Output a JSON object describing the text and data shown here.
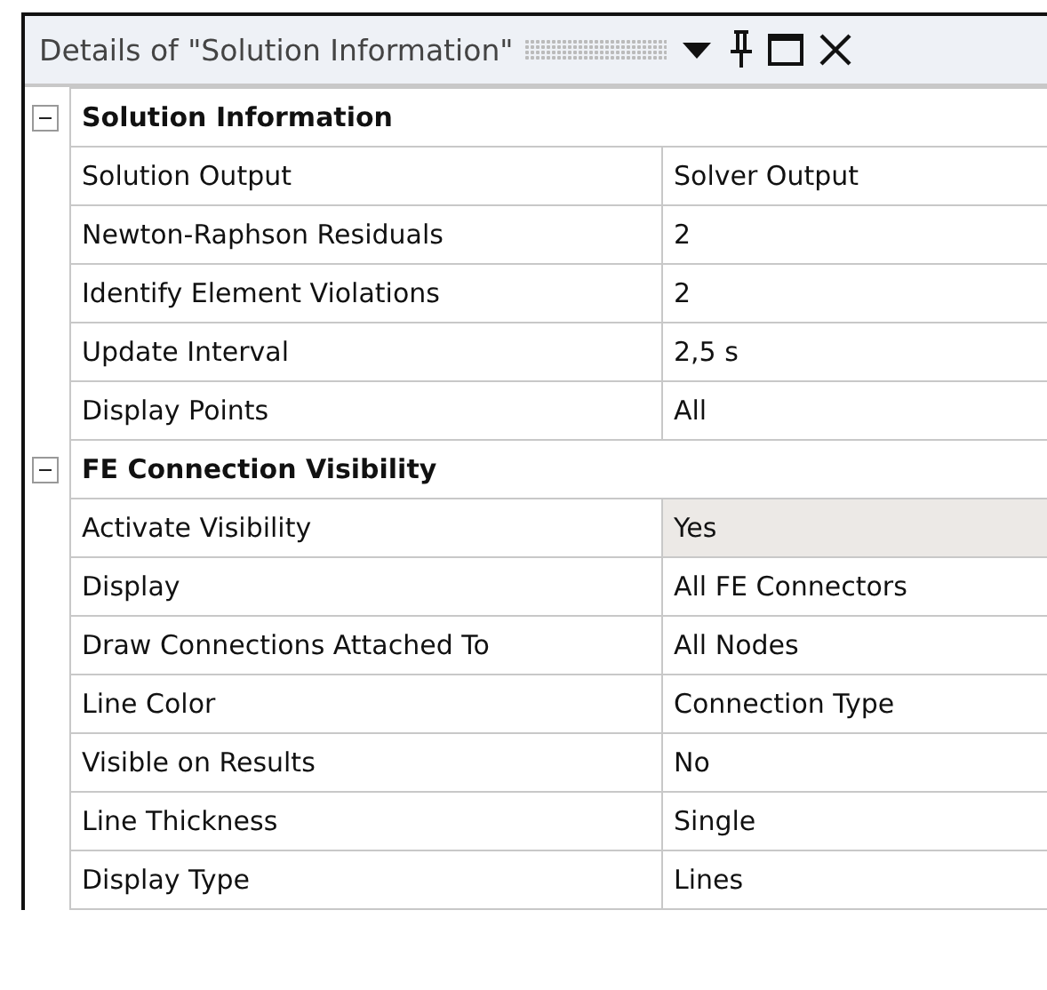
{
  "panel": {
    "title": "Details of \"Solution Information\""
  },
  "groups": [
    {
      "title": "Solution Information",
      "expanded": true,
      "rows": [
        {
          "name": "Solution Output",
          "value": "Solver Output",
          "highlighted": false
        },
        {
          "name": "Newton-Raphson Residuals",
          "value": "2",
          "highlighted": false
        },
        {
          "name": "Identify Element Violations",
          "value": "2",
          "highlighted": false
        },
        {
          "name": "Update Interval",
          "value": "2,5 s",
          "highlighted": false
        },
        {
          "name": "Display Points",
          "value": "All",
          "highlighted": false
        }
      ]
    },
    {
      "title": "FE Connection Visibility",
      "expanded": true,
      "rows": [
        {
          "name": "Activate Visibility",
          "value": "Yes",
          "highlighted": true
        },
        {
          "name": "Display",
          "value": "All FE Connectors",
          "highlighted": false
        },
        {
          "name": "Draw Connections Attached To",
          "value": "All Nodes",
          "highlighted": false
        },
        {
          "name": "Line Color",
          "value": "Connection Type",
          "highlighted": false
        },
        {
          "name": "Visible on Results",
          "value": "No",
          "highlighted": false
        },
        {
          "name": "Line Thickness",
          "value": "Single",
          "highlighted": false
        },
        {
          "name": "Display Type",
          "value": "Lines",
          "highlighted": false
        }
      ]
    }
  ]
}
